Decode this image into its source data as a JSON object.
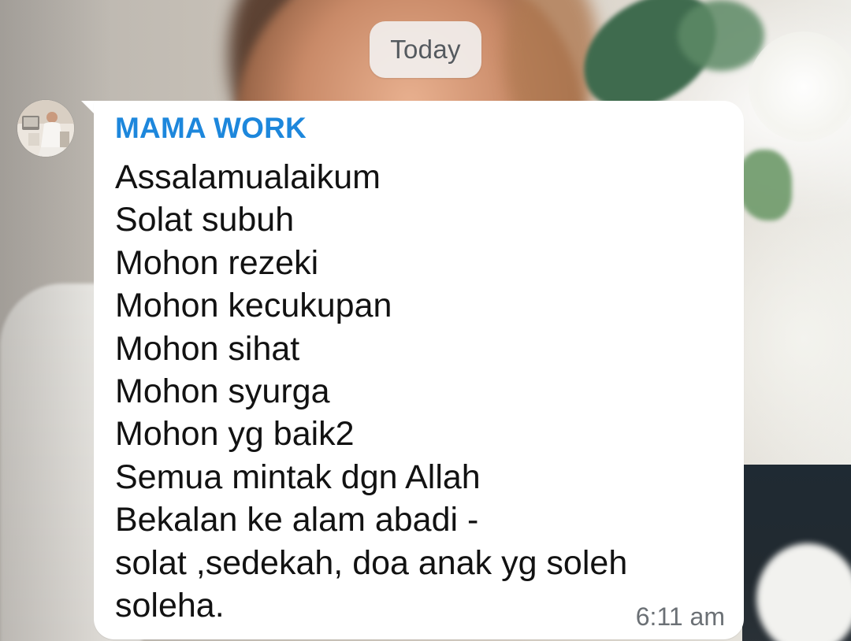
{
  "chat": {
    "date_divider": "Today",
    "message": {
      "sender": "MAMA WORK",
      "lines": [
        "Assalamualaikum",
        "Solat subuh",
        "Mohon rezeki",
        "Mohon kecukupan",
        "Mohon sihat",
        "Mohon syurga",
        "Mohon yg baik2",
        "Semua mintak dgn Allah",
        "Bekalan ke alam abadi -",
        "solat ,sedekah, doa anak yg soleh",
        "soleha."
      ],
      "time": "6:11 am"
    }
  },
  "colors": {
    "sender_name": "#1d87dc",
    "bubble_background": "#ffffff",
    "message_text": "#121212",
    "timestamp_text": "#6b7075",
    "date_pill_background": "#f2f2f2"
  },
  "icons": {
    "avatar": "contact-avatar"
  }
}
